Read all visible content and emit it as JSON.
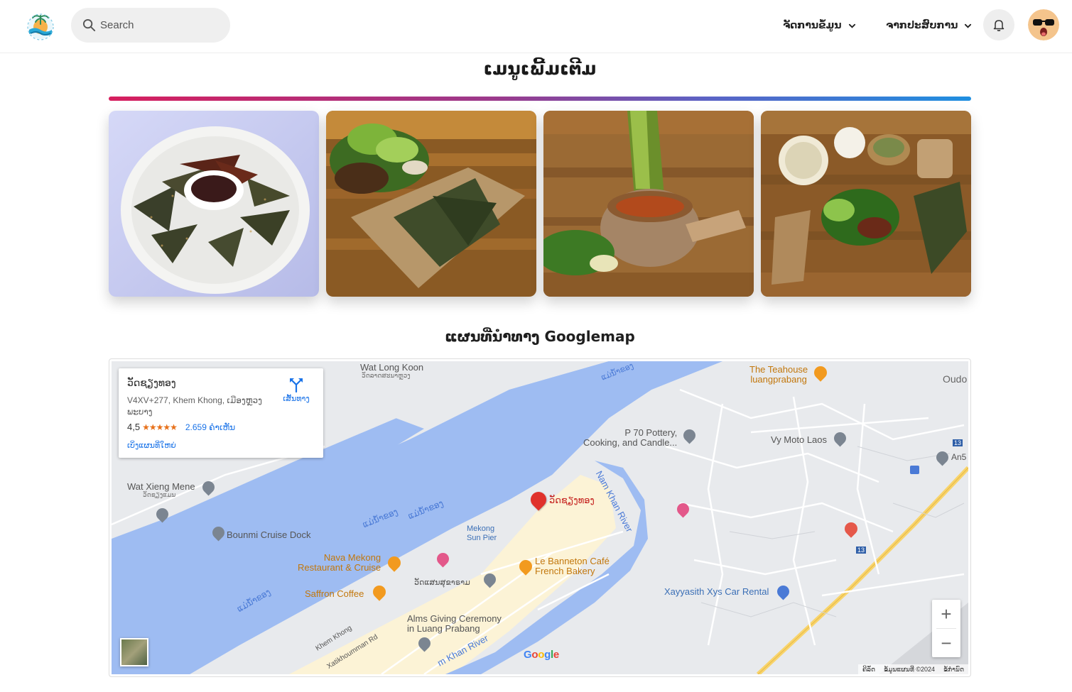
{
  "header": {
    "search_placeholder": "Search",
    "menu_manage_data": "ຈັດການຂໍ້ມູນ",
    "menu_experience": "ຈາກປະສົບການ"
  },
  "menu_section": {
    "title": "ເມນູເພີ້ມເຕີມ",
    "images": [
      "dried-river-weed-plate",
      "lao-food-tray",
      "bamboo-soup-mortar",
      "lao-meal-spread"
    ]
  },
  "map_section": {
    "title": "ແຜນທີ່ນຳທາງ Googlemap",
    "info_card": {
      "place_name": "ວັດຊຽງທອງ",
      "address": "V4XV+277, Khem Khong, ເມືອງຫຼວງພະບາງ",
      "rating": "4,5",
      "stars": "★★★★★",
      "reviews": "2.659 ຄຳເຫັນ",
      "directions_label": "ເສັ້ນທາງ",
      "larger_map_label": "ເບິ່ງແຜນທີ່ໃຫຍ່"
    },
    "zoom_in": "+",
    "zoom_out": "−",
    "google_logo": "Google",
    "footer": [
      "ຄີລັດ",
      "ຂໍ້ມູນແຜນທີ່ ©2024",
      "ຂໍ້ກຳນົດ"
    ],
    "labels": {
      "wat_long_koon": "Wat Long Koon",
      "wat_long_koon_lao": "ວັດລາດສະນາຫຼວງ",
      "teahouse": "The Teahouse",
      "teahouse_2": "luangprabang",
      "oudo": "Oudo",
      "p70": "P 70 Pottery,",
      "p70_2": "Cooking, and Candle...",
      "vy_moto": "Vy Moto Laos",
      "wat_xieng_mene": "Wat Xieng Mene",
      "wat_xieng_mene_lao": "ວັດຊຽງແມນ",
      "bounmi": "Bounmi Cruise Dock",
      "nam_khan": "Nam Khan River",
      "mekong_pier": "Mekong",
      "mekong_pier_2": "Sun Pier",
      "nava": "Nava Mekong",
      "nava_2": "Restaurant & Cruise",
      "saffron": "Saffron Coffee",
      "banneton": "Le Banneton Café",
      "banneton_2": "French Bakery",
      "xayyasith": "Xayyasith Xys Car Rental",
      "alms": "Alms Giving Ceremony",
      "alms_2": "in Luang Prabang",
      "khem_khong": "Khem Khong",
      "xatikhoumman": "Xatikhoumman Rd",
      "nam_khan_river_2": "m Khan River",
      "an5": "An5",
      "road13a": "13",
      "river_lao": "ແມ່ນ້ຳຂອງ",
      "pin_label": "ວັດຊຽງທອງ",
      "wat_saen": "ວັດແສນສຸຂາຣາມ"
    }
  }
}
